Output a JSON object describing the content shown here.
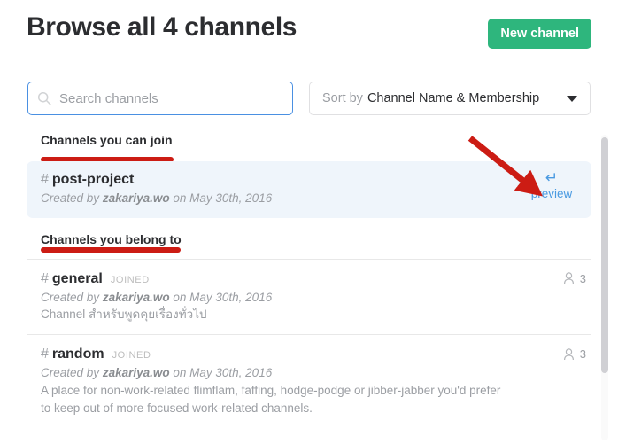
{
  "header": {
    "title": "Browse all 4 channels",
    "new_channel_button": "New channel"
  },
  "controls": {
    "search_placeholder": "Search channels",
    "search_value": "",
    "search_icon": "search-icon",
    "sort_prefix": "Sort by",
    "sort_value": "Channel Name & Membership",
    "dropdown_icon": "chevron-down-icon"
  },
  "sections": [
    {
      "heading": "Channels you can join",
      "annotated": true,
      "channels": [
        {
          "hash": "#",
          "name": "post-project",
          "joined": "",
          "created_prefix": "Created by",
          "creator": "zakariya.wo",
          "created_suffix": "on May 30th, 2016",
          "description": "",
          "members": "",
          "preview_glyph": "↵",
          "preview_label": "preview",
          "highlighted": true
        }
      ]
    },
    {
      "heading": "Channels you belong to",
      "annotated": true,
      "channels": [
        {
          "hash": "#",
          "name": "general",
          "joined": "JOINED",
          "created_prefix": "Created by",
          "creator": "zakariya.wo",
          "created_suffix": "on May 30th, 2016",
          "description": "Channel สำหรับพูดคุยเรื่องทั่วไป",
          "members": "3",
          "member_icon": "person-icon",
          "highlighted": false
        },
        {
          "hash": "#",
          "name": "random",
          "joined": "JOINED",
          "created_prefix": "Created by",
          "creator": "zakariya.wo",
          "created_suffix": "on May 30th, 2016",
          "description": "A place for non-work-related flimflam, faffing, hodge-podge or jibber-jabber you'd prefer to keep out of more focused work-related channels.",
          "members": "3",
          "member_icon": "person-icon",
          "highlighted": false
        }
      ]
    }
  ],
  "annotations": {
    "underline_color": "#cc1c14",
    "arrow_color": "#cc1c14",
    "arrow_target": "preview-link"
  },
  "colors": {
    "accent_green": "#2eb67d",
    "focus_blue": "#4a90e2",
    "link_blue": "#4a9ae1",
    "highlight_row": "#eff5fb",
    "text_primary": "#2c2d30",
    "text_muted": "#9b9ea3"
  },
  "scrollbar": {
    "name": "vertical-scrollbar"
  }
}
